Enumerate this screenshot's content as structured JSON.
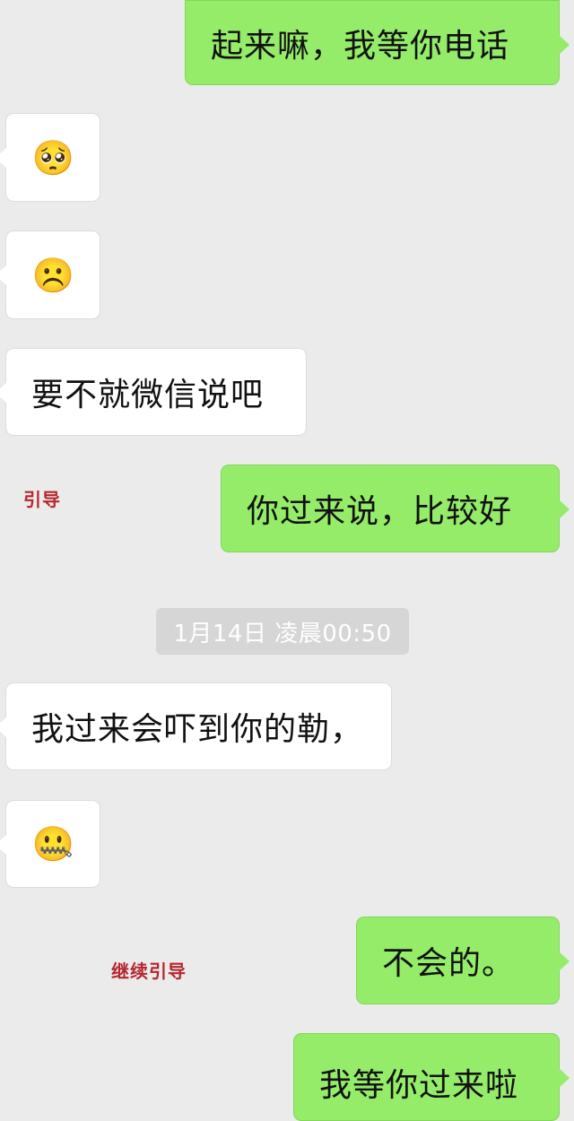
{
  "messages": [
    {
      "from": "me",
      "text": "起来嘛，我等你电话"
    },
    {
      "from": "other",
      "emoji": "🥺",
      "emoji_name": "flushed-face-icon"
    },
    {
      "from": "other",
      "emoji": "☹️",
      "emoji_name": "frowning-face-icon"
    },
    {
      "from": "other",
      "text": "要不就微信说吧"
    },
    {
      "from": "me",
      "text": "你过来说，比较好"
    },
    {
      "from": "other",
      "text": "我过来会吓到你的勒，"
    },
    {
      "from": "other",
      "emoji": "🤐",
      "emoji_name": "zipper-mouth-face-icon"
    },
    {
      "from": "me",
      "text": "不会的。"
    },
    {
      "from": "me",
      "text": "我等你过来啦"
    }
  ],
  "timestamp": "1月14日 凌晨00:50",
  "annotations": {
    "first": "引导",
    "second": "继续引导"
  },
  "colors": {
    "background": "#ebebeb",
    "outgoing_bubble": "#95ec69",
    "incoming_bubble": "#ffffff",
    "timestamp_bg": "#d6d6d6",
    "annotation": "#b5262d"
  }
}
